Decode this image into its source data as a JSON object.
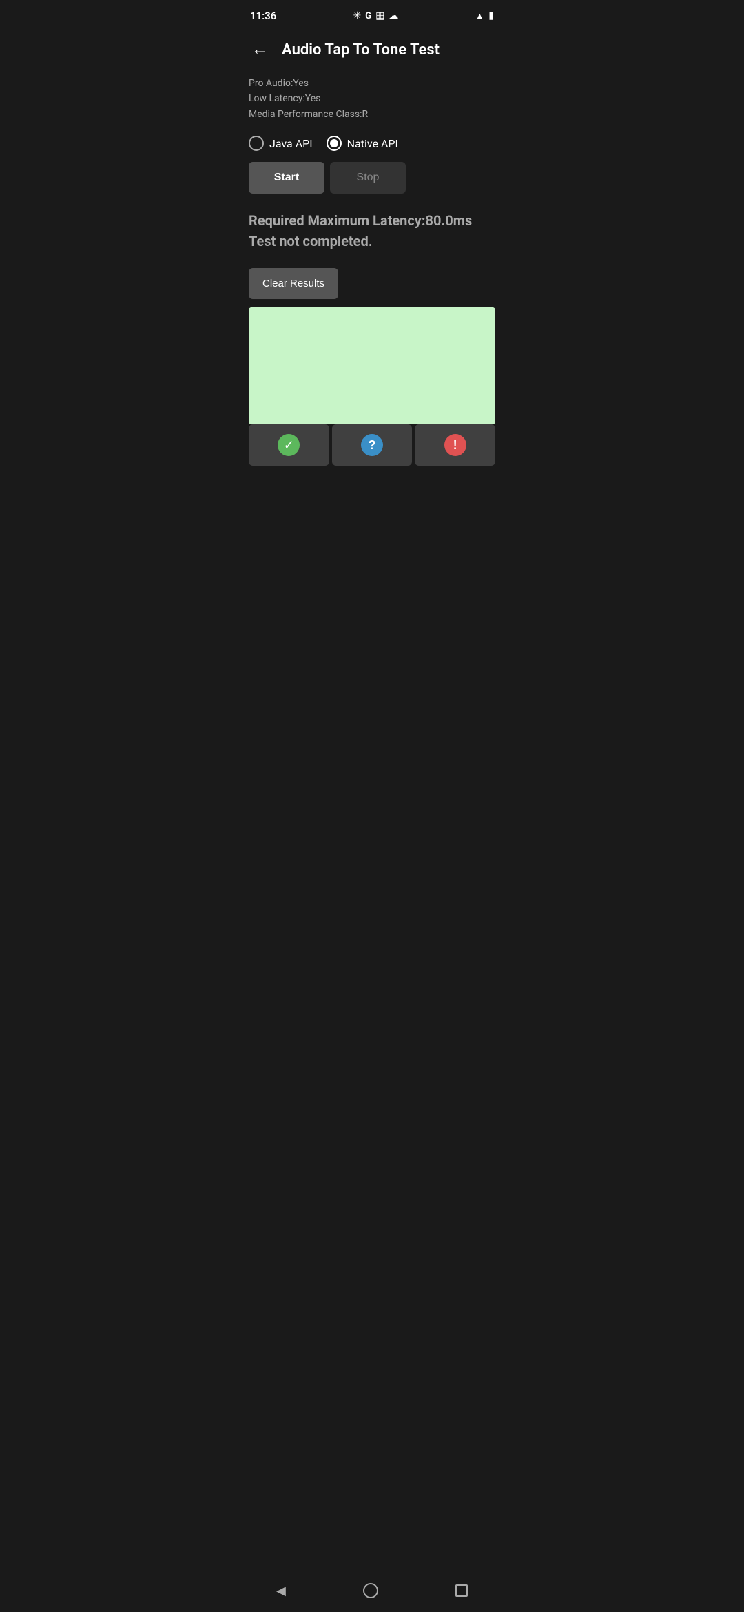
{
  "statusBar": {
    "time": "11:36",
    "iconsLeft": [
      "fan-icon",
      "google-icon",
      "calendar-icon",
      "cloud-icon"
    ],
    "iconsRight": [
      "wifi-icon",
      "battery-icon"
    ]
  },
  "header": {
    "backLabel": "←",
    "title": "Audio Tap To Tone Test"
  },
  "info": {
    "line1": "Pro Audio:Yes",
    "line2": "Low Latency:Yes",
    "line3": "Media Performance Class:R"
  },
  "radioGroup": {
    "options": [
      {
        "id": "java",
        "label": "Java API",
        "selected": false
      },
      {
        "id": "native",
        "label": "Native API",
        "selected": true
      }
    ]
  },
  "buttons": {
    "start": "Start",
    "stop": "Stop"
  },
  "result": {
    "line1": "Required Maximum Latency:80.0ms",
    "line2": "Test not completed."
  },
  "clearResults": {
    "label": "Clear Results"
  },
  "statusIcons": {
    "check": "✓",
    "question": "?",
    "exclamation": "!"
  },
  "navBar": {
    "back": "◀",
    "home": "○",
    "recent": "□"
  }
}
